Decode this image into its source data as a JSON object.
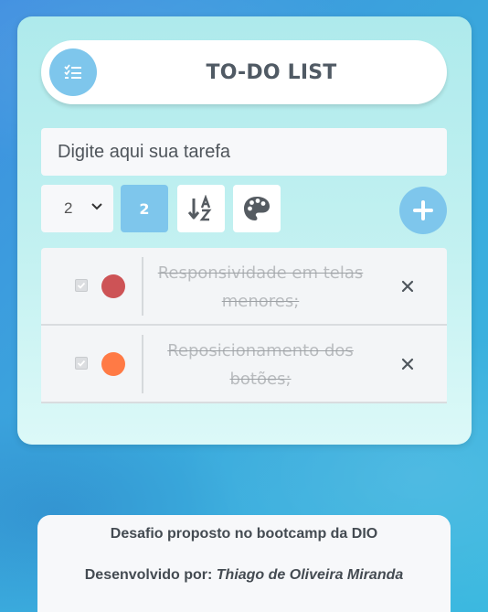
{
  "header": {
    "title": "TO-DO LIST",
    "icon": "checklist-icon"
  },
  "input": {
    "placeholder": "Digite aqui sua tarefa",
    "value": ""
  },
  "controls": {
    "select_value": "2",
    "count_label": "2",
    "sort_icon": "sort-alpha-icon",
    "palette_icon": "palette-icon",
    "add_icon": "plus-icon"
  },
  "tasks": [
    {
      "text": "Responsividade em telas menores;",
      "done": true,
      "color": "#cd5356"
    },
    {
      "text": "Reposicionamento dos botões;",
      "done": true,
      "color": "#ff7a45"
    }
  ],
  "footer": {
    "line1": "Desafio proposto no bootcamp da DIO",
    "line2_prefix": "Desenvolvido por:",
    "author": "Thiago de Oliveira Miranda"
  },
  "colors": {
    "accent": "#7ec6ec",
    "title": "#505a64"
  }
}
